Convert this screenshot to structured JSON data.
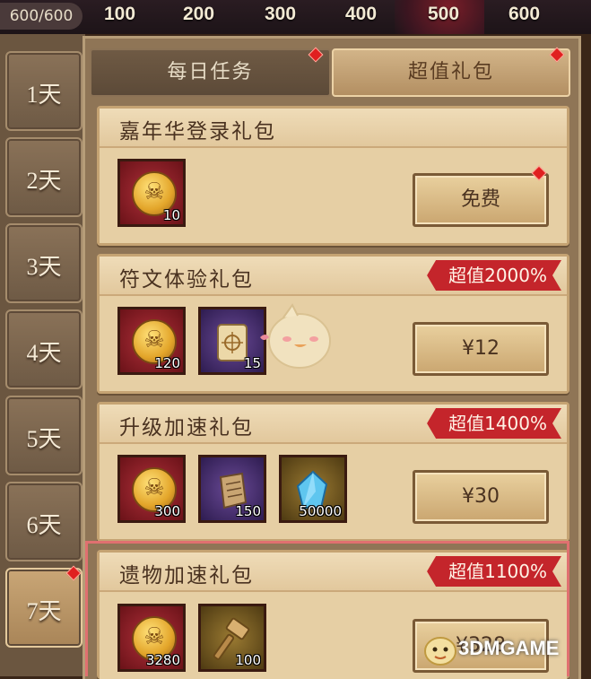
{
  "topbar": {
    "counter": "600/600",
    "milestones": [
      "100",
      "200",
      "300",
      "400",
      "500",
      "600"
    ]
  },
  "days": [
    "1天",
    "2天",
    "3天",
    "4天",
    "5天",
    "6天",
    "7天"
  ],
  "tabs": {
    "daily": "每日任务",
    "value_pack": "超值礼包"
  },
  "packs": [
    {
      "title": "嘉年华登录礼包",
      "badge": "",
      "button": "免费",
      "items": [
        {
          "icon": "skull-coin-icon",
          "qty": "10",
          "frame": "red"
        }
      ]
    },
    {
      "title": "符文体验礼包",
      "badge": "超值2000%",
      "button": "¥12",
      "items": [
        {
          "icon": "skull-coin-icon",
          "qty": "120",
          "frame": "red"
        },
        {
          "icon": "rune-scroll-icon",
          "qty": "15",
          "frame": "purple"
        }
      ]
    },
    {
      "title": "升级加速礼包",
      "badge": "超值1400%",
      "button": "¥30",
      "items": [
        {
          "icon": "skull-coin-icon",
          "qty": "300",
          "frame": "red"
        },
        {
          "icon": "scroll-icon",
          "qty": "150",
          "frame": "purple"
        },
        {
          "icon": "blue-crystal-icon",
          "qty": "50000",
          "frame": "gold"
        }
      ]
    },
    {
      "title": "遗物加速礼包",
      "badge": "超值1100%",
      "button": "¥328",
      "items": [
        {
          "icon": "skull-coin-icon",
          "qty": "3280",
          "frame": "red"
        },
        {
          "icon": "hammer-icon",
          "qty": "100",
          "frame": "gold"
        }
      ]
    }
  ],
  "watermark": "3DMGAME"
}
